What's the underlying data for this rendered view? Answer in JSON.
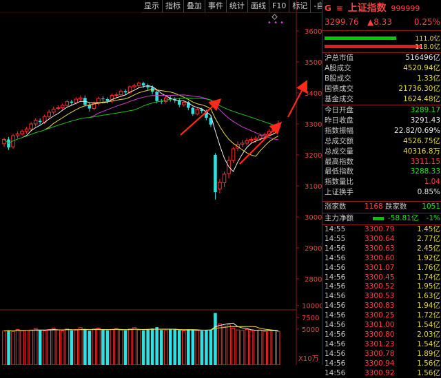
{
  "toolbar": {
    "items": [
      "显示",
      "指标",
      "叠加",
      "事件",
      "统计",
      "画线",
      "F10",
      "标记",
      "-自选",
      "返回"
    ]
  },
  "header": {
    "prefix": "G",
    "menu_icon": "menu-icon",
    "title": "上证指数",
    "code": "999999",
    "price": "3299.76",
    "change": "▲8.33",
    "change_pct": "0.25%"
  },
  "bars": {
    "buy_value": "111.0亿",
    "sell_value": "118.0亿",
    "buy_color": "#00c800",
    "sell_color": "#e02020"
  },
  "stats_a": [
    {
      "label": "沪总市值",
      "value": "516496亿",
      "color": "white"
    },
    {
      "label": "A股成交",
      "value": "4520.94亿",
      "color": "yellow"
    },
    {
      "label": "B股成交",
      "value": "1.33亿",
      "color": "yellow"
    },
    {
      "label": "国债成交",
      "value": "21736.30亿",
      "color": "yellow"
    },
    {
      "label": "基金成交",
      "value": "1624.48亿",
      "color": "yellow"
    }
  ],
  "stats_b": [
    {
      "label": "今日开盘",
      "value": "3289.17",
      "color": "green"
    },
    {
      "label": "昨日收盘",
      "value": "3291.43",
      "color": "white"
    },
    {
      "label": "指数振幅",
      "value": "22.82/0.69%",
      "color": "white"
    },
    {
      "label": "总成交额",
      "value": "4526.75亿",
      "color": "yellow"
    },
    {
      "label": "总成交量",
      "value": "40316.8万",
      "color": "yellow"
    },
    {
      "label": "最高指数",
      "value": "3311.15",
      "color": "red"
    },
    {
      "label": "最低指数",
      "value": "3288.33",
      "color": "green"
    },
    {
      "label": "指数量比",
      "value": "1.04",
      "color": "red"
    },
    {
      "label": "上证换手",
      "value": "0.85%",
      "color": "white"
    }
  ],
  "breadth": {
    "up_label": "涨家数",
    "up": "1168",
    "down_label": "跌家数",
    "down": "1051"
  },
  "net_flow": {
    "label": "主力净额",
    "value": "-58.81亿",
    "pct": "-1%"
  },
  "ticks": [
    {
      "t": "14:55",
      "p": "3300.79",
      "v": "1.45亿"
    },
    {
      "t": "14:55",
      "p": "3300.64",
      "v": "2.77亿"
    },
    {
      "t": "14:56",
      "p": "3300.63",
      "v": "2.45亿"
    },
    {
      "t": "14:56",
      "p": "3300.60",
      "v": "1.92亿"
    },
    {
      "t": "14:56",
      "p": "3301.07",
      "v": "1.76亿"
    },
    {
      "t": "14:56",
      "p": "3300.45",
      "v": "1.74亿"
    },
    {
      "t": "14:56",
      "p": "3300.52",
      "v": "1.95亿"
    },
    {
      "t": "14:56",
      "p": "3300.53",
      "v": "1.63亿"
    },
    {
      "t": "14:56",
      "p": "3300.83",
      "v": "1.94亿"
    },
    {
      "t": "14:56",
      "p": "3300.25",
      "v": "1.72亿"
    },
    {
      "t": "14:56",
      "p": "3301.00",
      "v": "1.54亿"
    },
    {
      "t": "14:56",
      "p": "3300.80",
      "v": "2.03亿"
    },
    {
      "t": "14:56",
      "p": "3301.23",
      "v": "1.54亿"
    },
    {
      "t": "14:56",
      "p": "3300.78",
      "v": "1.89亿"
    },
    {
      "t": "14:56",
      "p": "3300.94",
      "v": "1.56亿"
    },
    {
      "t": "14:56",
      "p": "3300.92",
      "v": "1.56亿"
    }
  ],
  "price_axis": [
    "3600",
    "3500",
    "3400",
    "3300",
    "3200",
    "3100",
    "3000",
    "2900",
    "2800"
  ],
  "volume_axis": [
    "10000",
    "7500",
    "5000"
  ],
  "volume_unit": "X10万",
  "chart_data": {
    "type": "candlestick",
    "price_ylim": [
      2700,
      3660
    ],
    "candles": [
      [
        3236,
        3250,
        3226,
        3256
      ],
      [
        3250,
        3224,
        3216,
        3258
      ],
      [
        3226,
        3262,
        3220,
        3268
      ],
      [
        3262,
        3268,
        3254,
        3276
      ],
      [
        3268,
        3276,
        3262,
        3282
      ],
      [
        3276,
        3284,
        3268,
        3290
      ],
      [
        3284,
        3300,
        3278,
        3306
      ],
      [
        3300,
        3312,
        3292,
        3318
      ],
      [
        3310,
        3306,
        3298,
        3318
      ],
      [
        3306,
        3324,
        3300,
        3330
      ],
      [
        3324,
        3338,
        3318,
        3346
      ],
      [
        3338,
        3348,
        3330,
        3356
      ],
      [
        3350,
        3352,
        3344,
        3360
      ],
      [
        3352,
        3360,
        3346,
        3366
      ],
      [
        3360,
        3372,
        3352,
        3378
      ],
      [
        3372,
        3368,
        3360,
        3378
      ],
      [
        3368,
        3380,
        3362,
        3386
      ],
      [
        3380,
        3384,
        3374,
        3392
      ],
      [
        3384,
        3362,
        3356,
        3392
      ],
      [
        3362,
        3350,
        3340,
        3368
      ],
      [
        3350,
        3366,
        3344,
        3372
      ],
      [
        3366,
        3382,
        3360,
        3388
      ],
      [
        3382,
        3380,
        3372,
        3390
      ],
      [
        3380,
        3374,
        3366,
        3386
      ],
      [
        3374,
        3392,
        3368,
        3398
      ],
      [
        3392,
        3394,
        3384,
        3402
      ],
      [
        3394,
        3406,
        3388,
        3412
      ],
      [
        3406,
        3402,
        3394,
        3412
      ],
      [
        3402,
        3420,
        3396,
        3424
      ],
      [
        3420,
        3424,
        3414,
        3430
      ],
      [
        3424,
        3432,
        3418,
        3436
      ],
      [
        3432,
        3424,
        3416,
        3436
      ],
      [
        3424,
        3418,
        3410,
        3430
      ],
      [
        3418,
        3404,
        3396,
        3424
      ],
      [
        3404,
        3374,
        3366,
        3410
      ],
      [
        3374,
        3372,
        3364,
        3380
      ],
      [
        3372,
        3384,
        3366,
        3390
      ],
      [
        3384,
        3380,
        3372,
        3390
      ],
      [
        3380,
        3376,
        3368,
        3386
      ],
      [
        3376,
        3362,
        3354,
        3382
      ],
      [
        3362,
        3370,
        3356,
        3376
      ],
      [
        3370,
        3352,
        3344,
        3374
      ],
      [
        3352,
        3332,
        3326,
        3356
      ],
      [
        3332,
        3348,
        3328,
        3354
      ],
      [
        3348,
        3342,
        3334,
        3352
      ],
      [
        3342,
        3320,
        3312,
        3346
      ],
      [
        3320,
        3298,
        3290,
        3324
      ],
      [
        3200,
        3080,
        3056,
        3206
      ],
      [
        3090,
        3112,
        3076,
        3122
      ],
      [
        3110,
        3138,
        3096,
        3146
      ],
      [
        3140,
        3182,
        3124,
        3196
      ],
      [
        3182,
        3220,
        3174,
        3226
      ],
      [
        3222,
        3234,
        3212,
        3244
      ],
      [
        3234,
        3238,
        3226,
        3248
      ],
      [
        3238,
        3246,
        3230,
        3254
      ],
      [
        3246,
        3250,
        3238,
        3258
      ],
      [
        3250,
        3254,
        3240,
        3262
      ],
      [
        3254,
        3262,
        3246,
        3268
      ],
      [
        3262,
        3266,
        3254,
        3272
      ],
      [
        3266,
        3276,
        3260,
        3282
      ],
      [
        3276,
        3282,
        3268,
        3290
      ],
      [
        3289,
        3300,
        3288,
        3311
      ]
    ],
    "volumes": [
      4600,
      4700,
      4500,
      4900,
      4600,
      4700,
      4800,
      5100,
      4700,
      4600,
      4900,
      5200,
      4800,
      4600,
      5000,
      4700,
      4900,
      5300,
      4800,
      4600,
      5000,
      5200,
      4800,
      4700,
      4900,
      5100,
      4800,
      4700,
      5000,
      5300,
      4800,
      4700,
      4900,
      5100,
      5400,
      4800,
      4700,
      4900,
      5000,
      4700,
      4600,
      4800,
      4900,
      4700,
      4600,
      4800,
      4900,
      8400,
      6100,
      5600,
      5900,
      5200,
      4800,
      4700,
      4900,
      4600,
      4700,
      4800,
      4500,
      4600,
      4700,
      4500
    ],
    "volume_ylim": [
      0,
      12000
    ],
    "annotations": [
      "red arrows indicating trend"
    ]
  }
}
